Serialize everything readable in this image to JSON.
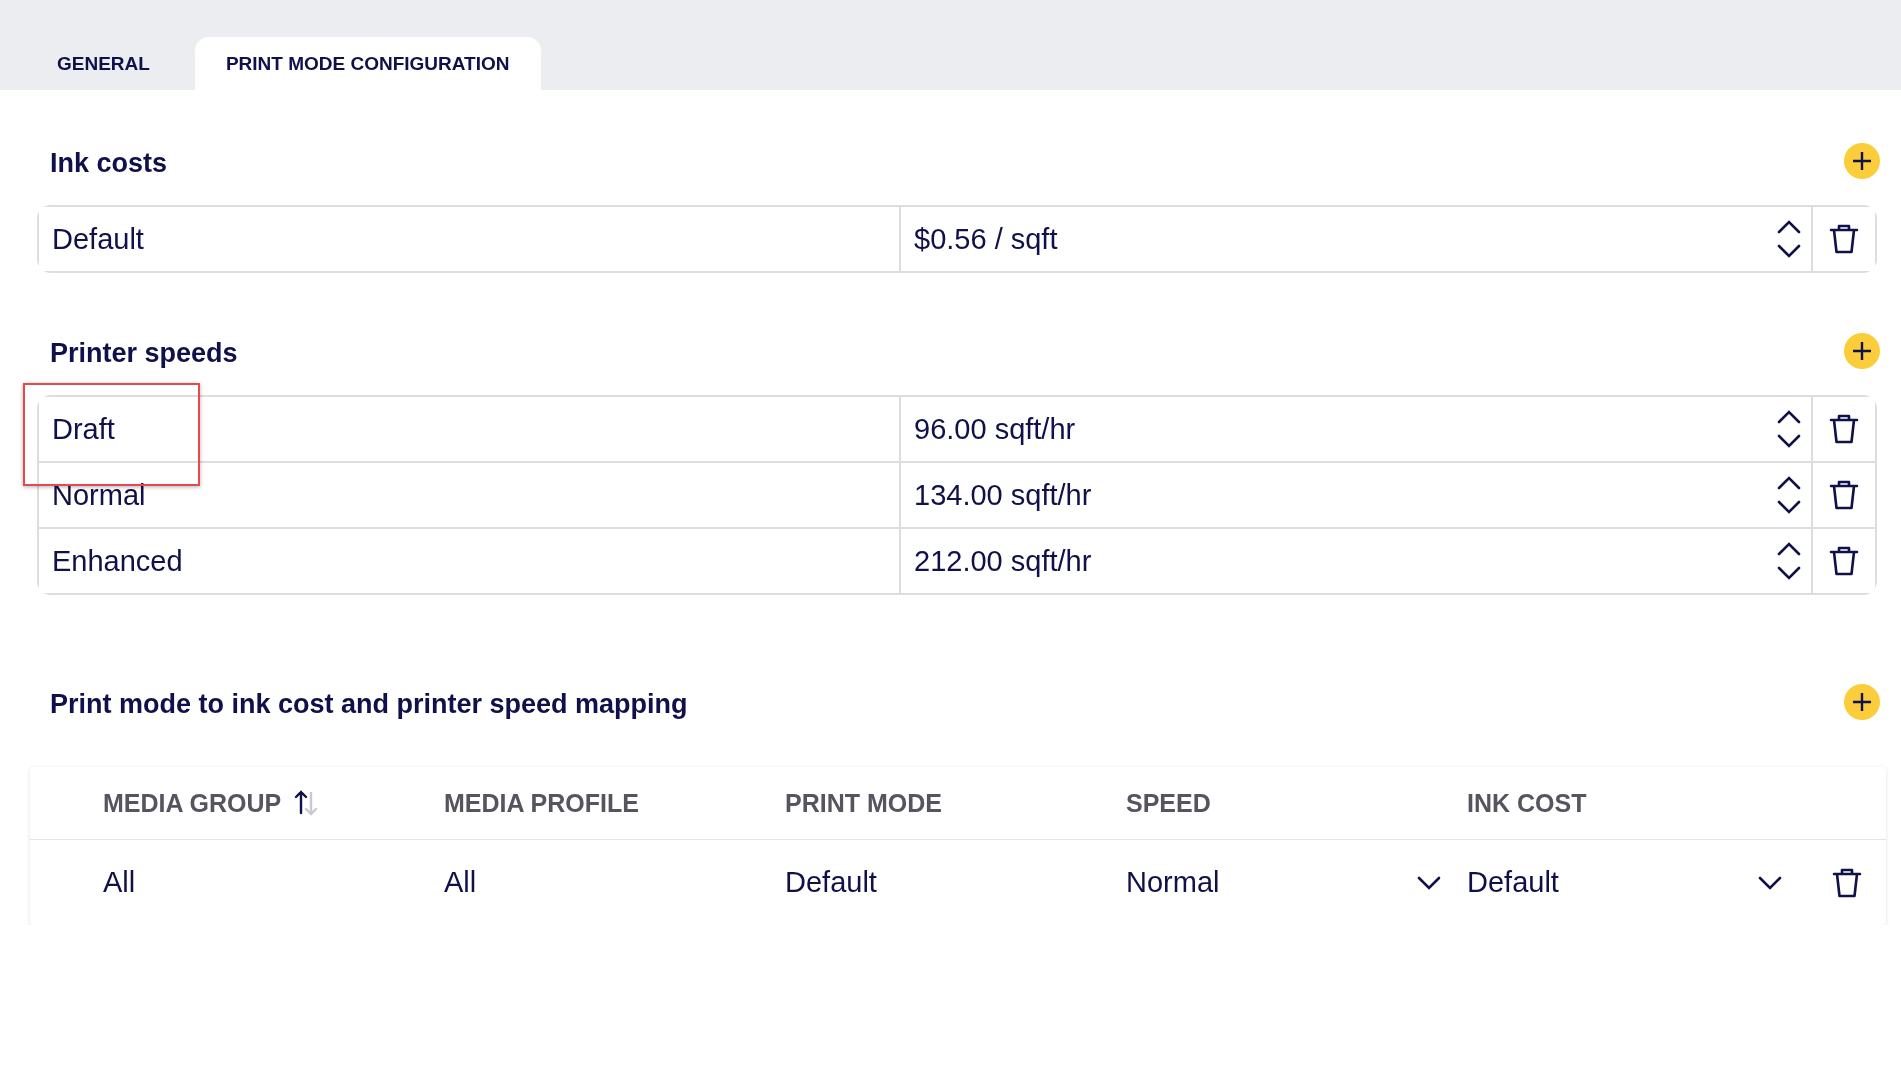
{
  "tabs": [
    {
      "label": "GENERAL",
      "selected": false
    },
    {
      "label": "PRINT MODE CONFIGURATION",
      "selected": true
    }
  ],
  "ink_costs": {
    "title": "Ink costs",
    "rows": [
      {
        "name": "Default",
        "value": "$0.56 / sqft",
        "highlighted": false
      }
    ]
  },
  "printer_speeds": {
    "title": "Printer speeds",
    "rows": [
      {
        "name": "Draft",
        "value": "96.00 sqft/hr",
        "highlighted": true
      },
      {
        "name": "Normal",
        "value": "134.00 sqft/hr",
        "highlighted": false
      },
      {
        "name": "Enhanced",
        "value": "212.00 sqft/hr",
        "highlighted": false
      }
    ]
  },
  "mapping": {
    "title": "Print mode to ink cost and printer speed mapping",
    "columns": [
      {
        "label": "MEDIA GROUP",
        "sorted_ascending": true
      },
      {
        "label": "MEDIA PROFILE",
        "sorted_ascending": false
      },
      {
        "label": "PRINT MODE",
        "sorted_ascending": false
      },
      {
        "label": "SPEED",
        "sorted_ascending": false
      },
      {
        "label": "INK COST",
        "sorted_ascending": false
      }
    ],
    "rows": [
      {
        "cells": [
          {
            "kind": "text",
            "value": "All"
          },
          {
            "kind": "text",
            "value": "All"
          },
          {
            "kind": "text",
            "value": "Default"
          },
          {
            "kind": "select",
            "value": "Normal"
          },
          {
            "kind": "select",
            "value": "Default"
          }
        ]
      }
    ]
  }
}
